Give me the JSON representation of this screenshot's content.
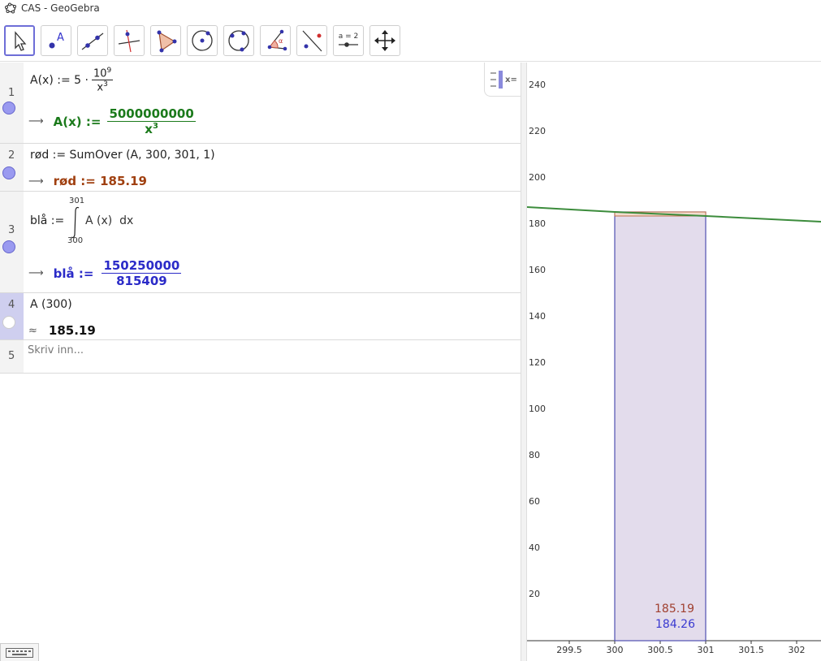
{
  "window": {
    "title": "CAS - GeoGebra"
  },
  "toolbar": {
    "tools": [
      "move-tool",
      "point-tool",
      "line-tool",
      "perpendicular-tool",
      "polygon-tool",
      "circle-center-tool",
      "circle-three-points-tool",
      "angle-tool",
      "reflect-tool",
      "slider-tool",
      "move-graphics-tool"
    ],
    "slider_label": "a = 2",
    "angle_symbol": "α"
  },
  "cas": {
    "rows": [
      {
        "num": "1",
        "input_lhs": "A(x) := 5 ·",
        "input_num_base": "10",
        "input_num_exp": "9",
        "input_den_base": "x",
        "input_den_exp": "3",
        "output_lhs": "A(x) :=",
        "output_num": "5000000000",
        "output_den_base": "x",
        "output_den_exp": "3"
      },
      {
        "num": "2",
        "input": "rød := SumOver (A, 300, 301, 1)",
        "output": "rød := 185.19"
      },
      {
        "num": "3",
        "input_lhs": "blå :=",
        "integral_upper": "301",
        "integral_lower": "300",
        "integrand": "A (x)  dx",
        "output_lhs": "blå :=",
        "output_num": "150250000",
        "output_den": "815409"
      },
      {
        "num": "4",
        "input": "A (300)",
        "approx_symbol": "≈",
        "output": "185.19"
      },
      {
        "num": "5",
        "placeholder": "Skriv inn..."
      }
    ]
  },
  "graphics": {
    "y_ticks": [
      "240",
      "220",
      "200",
      "180",
      "160",
      "140",
      "120",
      "100",
      "80",
      "60",
      "40",
      "20"
    ],
    "x_ticks": [
      "299.5",
      "300",
      "300.5",
      "301",
      "301.5",
      "302"
    ],
    "labels": {
      "red_value": "185.19",
      "blue_value": "184.26"
    },
    "colors": {
      "curve": "#3c8c3c",
      "red_rect": "#c0704a",
      "blue_rect": "#5050b0",
      "blue_fill": "#e3dcec"
    }
  },
  "algebra_toggle_icon": "algebra-view-icon",
  "keyboard_icon": "keyboard-icon"
}
